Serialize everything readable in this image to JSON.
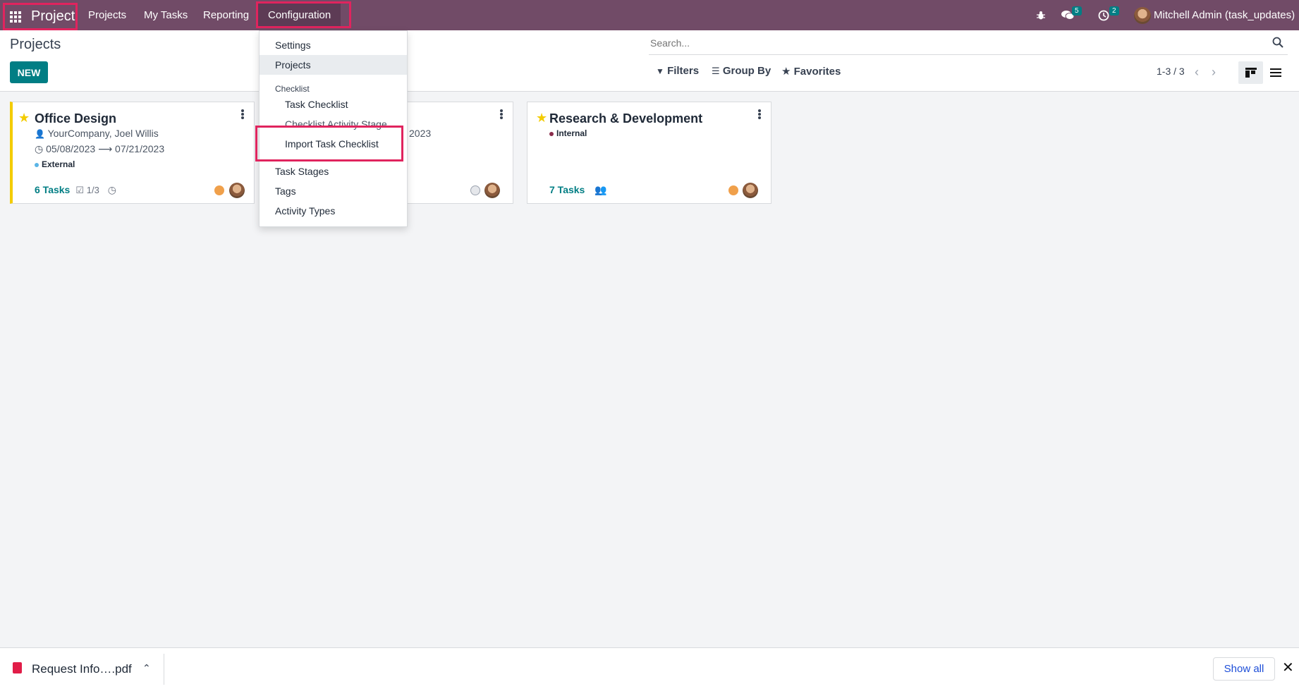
{
  "navbar": {
    "brand": "Project",
    "menus": [
      "Projects",
      "My Tasks",
      "Reporting",
      "Configuration"
    ],
    "messages_count": "5",
    "activities_count": "2",
    "user": "Mitchell Admin (task_updates)"
  },
  "control_panel": {
    "title": "Projects",
    "new_label": "NEW",
    "search_placeholder": "Search...",
    "filters_label": "Filters",
    "groupby_label": "Group By",
    "favorites_label": "Favorites",
    "pager": "1-3 / 3"
  },
  "dropdown": {
    "settings": "Settings",
    "projects": "Projects",
    "checklist_header": "Checklist",
    "task_checklist": "Task Checklist",
    "checklist_activity_stage": "Checklist Activity Stage",
    "import_task_checklist": "Import Task Checklist",
    "task_stages": "Task Stages",
    "tags": "Tags",
    "activity_types": "Activity Types"
  },
  "cards": [
    {
      "title": "Office Design",
      "partner": "YourCompany, Joel Willis",
      "date_start": "05/08/2023",
      "date_end": "07/21/2023",
      "tag": "External",
      "tag_color": "#5ab4e6",
      "tasks": "6 Tasks",
      "checklist": "1/3",
      "status_color": "#f0a04b"
    },
    {
      "date_fragment": "2023",
      "status_color": "#e5e7eb"
    },
    {
      "title": "Research & Development",
      "tag": "Internal",
      "tag_color": "#8a2b4a",
      "tasks": "7 Tasks",
      "status_color": "#f0a04b"
    }
  ],
  "download": {
    "file": "Request Info….pdf",
    "show_all": "Show all"
  },
  "colors": {
    "navbar": "#714b67",
    "primary": "#017e84",
    "highlight": "#e0245e",
    "star": "#f3cc00"
  }
}
